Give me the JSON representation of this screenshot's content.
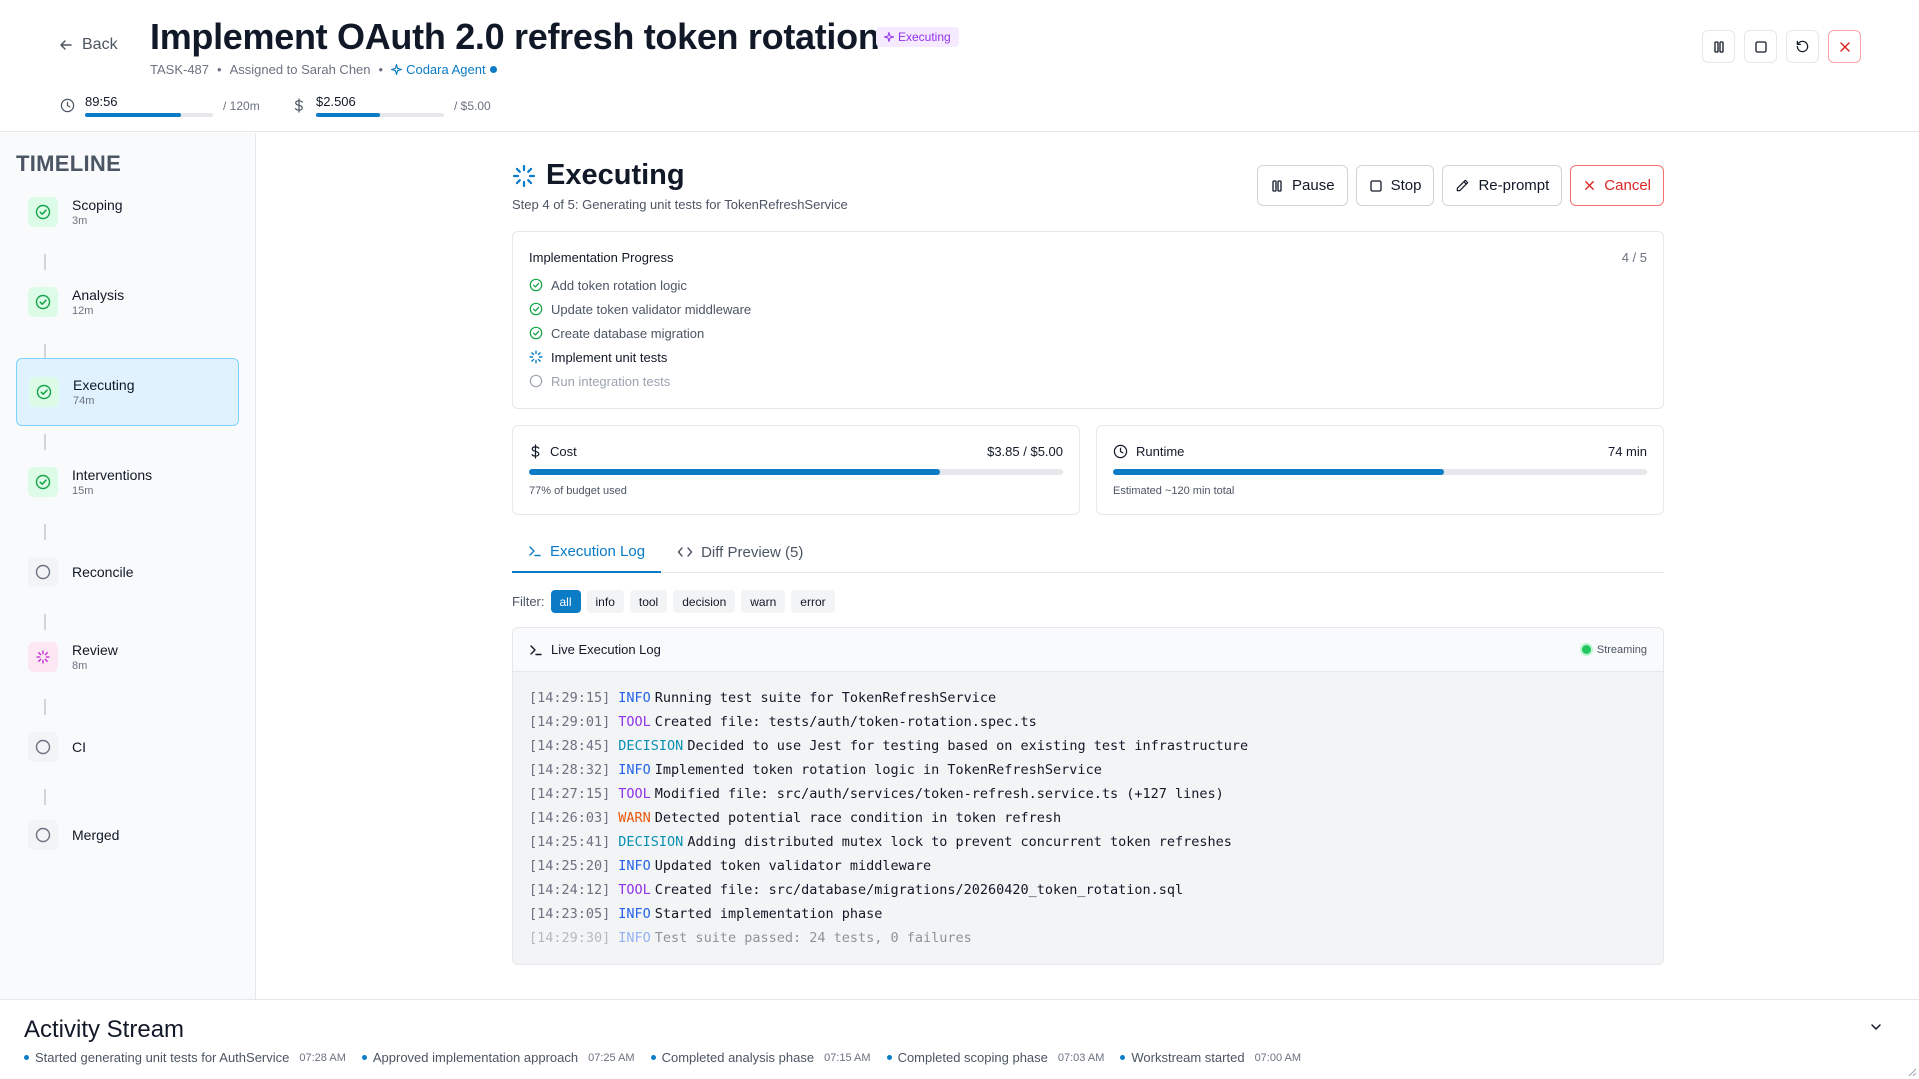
{
  "header": {
    "back_label": "Back",
    "title": "Implement OAuth 2.0 refresh token rotation",
    "status_badge": "Executing",
    "task_id": "TASK-487",
    "assigned": "Assigned to Sarah Chen",
    "agent": "Codara Agent",
    "time_used": "89:56",
    "time_max": "/ 120m",
    "time_fraction": 0.75,
    "cost_used": "$2.506",
    "cost_max": "/ $5.00",
    "cost_fraction": 0.5
  },
  "sidebar": {
    "title": "TIMELINE",
    "items": [
      {
        "label": "Scoping",
        "time": "3m",
        "state": "done"
      },
      {
        "label": "Analysis",
        "time": "12m",
        "state": "done"
      },
      {
        "label": "Executing",
        "time": "74m",
        "state": "done"
      },
      {
        "label": "Interventions",
        "time": "15m",
        "state": "done"
      },
      {
        "label": "Reconcile",
        "time": "",
        "state": "pending"
      },
      {
        "label": "Review",
        "time": "8m",
        "state": "review"
      },
      {
        "label": "CI",
        "time": "",
        "state": "pending"
      },
      {
        "label": "Merged",
        "time": "",
        "state": "pending"
      }
    ]
  },
  "main": {
    "title": "Executing",
    "subtitle": "Step 4 of 5: Generating unit tests for TokenRefreshService",
    "actions": {
      "pause": "Pause",
      "stop": "Stop",
      "reprompt": "Re-prompt",
      "cancel": "Cancel"
    },
    "progress": {
      "title": "Implementation Progress",
      "count": "4 / 5",
      "items": [
        {
          "label": "Add token rotation logic",
          "state": "done"
        },
        {
          "label": "Update token validator middleware",
          "state": "done"
        },
        {
          "label": "Create database migration",
          "state": "done"
        },
        {
          "label": "Implement unit tests",
          "state": "current"
        },
        {
          "label": "Run integration tests",
          "state": "pending"
        }
      ]
    },
    "cost": {
      "label": "Cost",
      "value": "$3.85 / $5.00",
      "note": "77% of budget used",
      "fraction": 0.77
    },
    "runtime": {
      "label": "Runtime",
      "value": "74 min",
      "note": "Estimated ~120 min total",
      "fraction": 0.62
    },
    "tabs": {
      "log": "Execution Log",
      "diff": "Diff Preview (5)"
    },
    "filter_label": "Filter:",
    "filters": [
      "all",
      "info",
      "tool",
      "decision",
      "warn",
      "error"
    ],
    "log": {
      "title": "Live Execution Log",
      "streaming": "Streaming",
      "lines": [
        {
          "ts": "[14:29:15]",
          "level": "INFO",
          "msg": "Running test suite for TokenRefreshService"
        },
        {
          "ts": "[14:29:01]",
          "level": "TOOL",
          "msg": "Created file: tests/auth/token-rotation.spec.ts"
        },
        {
          "ts": "[14:28:45]",
          "level": "DECISION",
          "msg": "Decided to use Jest for testing based on existing test infrastructure"
        },
        {
          "ts": "[14:28:32]",
          "level": "INFO",
          "msg": "Implemented token rotation logic in TokenRefreshService"
        },
        {
          "ts": "[14:27:15]",
          "level": "TOOL",
          "msg": "Modified file: src/auth/services/token-refresh.service.ts (+127 lines)"
        },
        {
          "ts": "[14:26:03]",
          "level": "WARN",
          "msg": "Detected potential race condition in token refresh"
        },
        {
          "ts": "[14:25:41]",
          "level": "DECISION",
          "msg": "Adding distributed mutex lock to prevent concurrent token refreshes"
        },
        {
          "ts": "[14:25:20]",
          "level": "INFO",
          "msg": "Updated token validator middleware"
        },
        {
          "ts": "[14:24:12]",
          "level": "TOOL",
          "msg": "Created file: src/database/migrations/20260420_token_rotation.sql"
        },
        {
          "ts": "[14:23:05]",
          "level": "INFO",
          "msg": "Started implementation phase"
        },
        {
          "ts": "[14:29:30]",
          "level": "INFO",
          "msg": "Test suite passed: 24 tests, 0 failures"
        }
      ]
    }
  },
  "activity": {
    "title": "Activity Stream",
    "events": [
      {
        "text": "Started generating unit tests for AuthService",
        "time": "07:28 AM"
      },
      {
        "text": "Approved implementation approach",
        "time": "07:25 AM"
      },
      {
        "text": "Completed analysis phase",
        "time": "07:15 AM"
      },
      {
        "text": "Completed scoping phase",
        "time": "07:03 AM"
      },
      {
        "text": "Workstream started",
        "time": "07:00 AM"
      }
    ]
  },
  "colors": {
    "accent": "#0b7bc6",
    "success": "#16a34a",
    "danger": "#dc2626",
    "executing": "#9333ea"
  }
}
